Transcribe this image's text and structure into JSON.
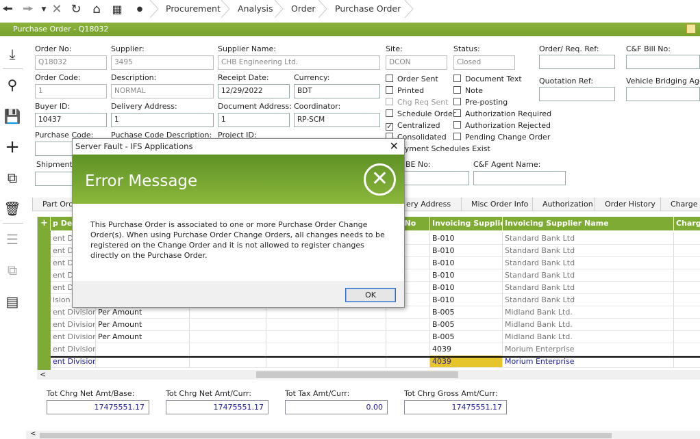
{
  "breadcrumb": [
    "Procurement",
    "Analysis",
    "Order",
    "Purchase Order"
  ],
  "title": "Purchase Order - Q18032",
  "header": {
    "order_no_label": "Order No:",
    "order_no": "Q18032",
    "supplier_label": "Supplier:",
    "supplier": "3495",
    "supplier_name_label": "Supplier Name:",
    "supplier_name": "CHB Engineering Ltd.",
    "site_label": "Site:",
    "site": "DCON",
    "status_label": "Status:",
    "status": "Closed",
    "order_req_ref_label": "Order/ Req. Ref:",
    "order_req_ref": "",
    "cf_bill_no_label": "C&F Bill No:",
    "cf_bill_no": "",
    "order_code_label": "Order Code:",
    "order_code": "1",
    "description_label": "Description:",
    "description": "NORMAL",
    "receipt_date_label": "Receipt Date:",
    "receipt_date": "12/29/2022",
    "currency_label": "Currency:",
    "currency": "BDT",
    "quotation_ref_label": "Quotation Ref:",
    "quotation_ref": "",
    "vehicle_bridging_label": "Vehicle Bridging Agent",
    "vehicle_bridging": "",
    "buyer_id_label": "Buyer ID:",
    "buyer_id": "10437",
    "delivery_address_label": "Delivery Address:",
    "delivery_address": "1",
    "document_address_label": "Document Address:",
    "document_address": "1",
    "coordinator_label": "Coordinator:",
    "coordinator": "RP-SCM",
    "purchase_code_label": "Purchase Code:",
    "purchase_code_desc_label": "Puchase Code Description:",
    "project_id_label": "Project ID:",
    "shipment_label": "Shipment D",
    "be_no_label": "BE No:",
    "cf_agent_label": "C&F Agent Name:"
  },
  "checkboxes": {
    "order_sent": {
      "label": "Order Sent",
      "checked": false
    },
    "printed": {
      "label": "Printed",
      "checked": false
    },
    "chg_req_sent": {
      "label": "Chg Req Sent",
      "checked": false
    },
    "schedule_order": {
      "label": "Schedule Order",
      "checked": false
    },
    "centralized": {
      "label": "Centralized",
      "checked": true
    },
    "consolidated": {
      "label": "Consolidated",
      "checked": false
    },
    "payment_schedules": {
      "label": "ayment Schedules Exist",
      "checked": false
    },
    "document_text": {
      "label": "Document Text",
      "checked": false
    },
    "note": {
      "label": "Note",
      "checked": false
    },
    "pre_posting": {
      "label": "Pre-posting",
      "checked": false
    },
    "authorization_required": {
      "label": "Authorization Required",
      "checked": false
    },
    "authorization_rejected": {
      "label": "Authorization Rejected",
      "checked": false
    },
    "pending_change_order": {
      "label": "Pending Change Order",
      "checked": false
    }
  },
  "tabs": [
    "Part Orde",
    "ery Address",
    "Misc Order Info",
    "Authorization",
    "Order History",
    "Charge H"
  ],
  "grid": {
    "headers": [
      "p Desc",
      "Rel No",
      "Invoicing Supplier",
      "Invoicing Supplier Name",
      "Charge"
    ],
    "rows": [
      {
        "desc": "ent Divi",
        "type": "",
        "supplier": "B-010",
        "name": "Standard Bank Ltd"
      },
      {
        "desc": "ent Divi",
        "type": "",
        "supplier": "B-010",
        "name": "Standard Bank Ltd"
      },
      {
        "desc": "ent Divi",
        "type": "",
        "supplier": "B-010",
        "name": "Standard Bank Ltd"
      },
      {
        "desc": "ent Divi",
        "type": "",
        "supplier": "B-010",
        "name": "Standard Bank Ltd"
      },
      {
        "desc": "ent Divi",
        "type": "",
        "supplier": "B-010",
        "name": "Standard Bank Ltd"
      },
      {
        "desc": "ision",
        "type": "",
        "supplier": "B-010",
        "name": "Standard Bank Ltd"
      },
      {
        "desc": "ent Division",
        "type": "Per Amount",
        "supplier": "B-005",
        "name": "Midland Bank Ltd."
      },
      {
        "desc": "ent Division",
        "type": "Per Amount",
        "supplier": "B-005",
        "name": "Midland Bank Ltd."
      },
      {
        "desc": "ent Division",
        "type": "Per Amount",
        "supplier": "B-005",
        "name": "Midland Bank Ltd."
      },
      {
        "desc": "ent Division",
        "type": "",
        "supplier": "4039",
        "name": "Morium Enterprise"
      },
      {
        "desc": "ent Division",
        "type": "",
        "supplier": "4039",
        "name": "Morium Enterprise"
      }
    ]
  },
  "totals": {
    "net_base_label": "Tot Chrg Net Amt/Base:",
    "net_base": "17475551.17",
    "net_curr_label": "Tot Chrg Net Amt/Curr:",
    "net_curr": "17475551.17",
    "tax_curr_label": "Tot Tax Amt/Curr:",
    "tax_curr": "0.00",
    "gross_curr_label": "Tot Chrg Gross Amt/Curr:",
    "gross_curr": "17475551.17"
  },
  "dialog": {
    "window_title": "Server Fault - IFS Applications",
    "heading": "Error Message",
    "message": "This Purchase Order is associated to one or more Purchase Order Change Order(s). When using Purchase Order Change Orders, all changes needs to be registered on the Change Order and it is not allowed to register changes directly on the Purchase Order.",
    "ok_label": "OK"
  },
  "colors": {
    "accent": "#7eab33",
    "dialog_banner": "#6e9f2e",
    "selected_cell": "#e6c52c"
  }
}
